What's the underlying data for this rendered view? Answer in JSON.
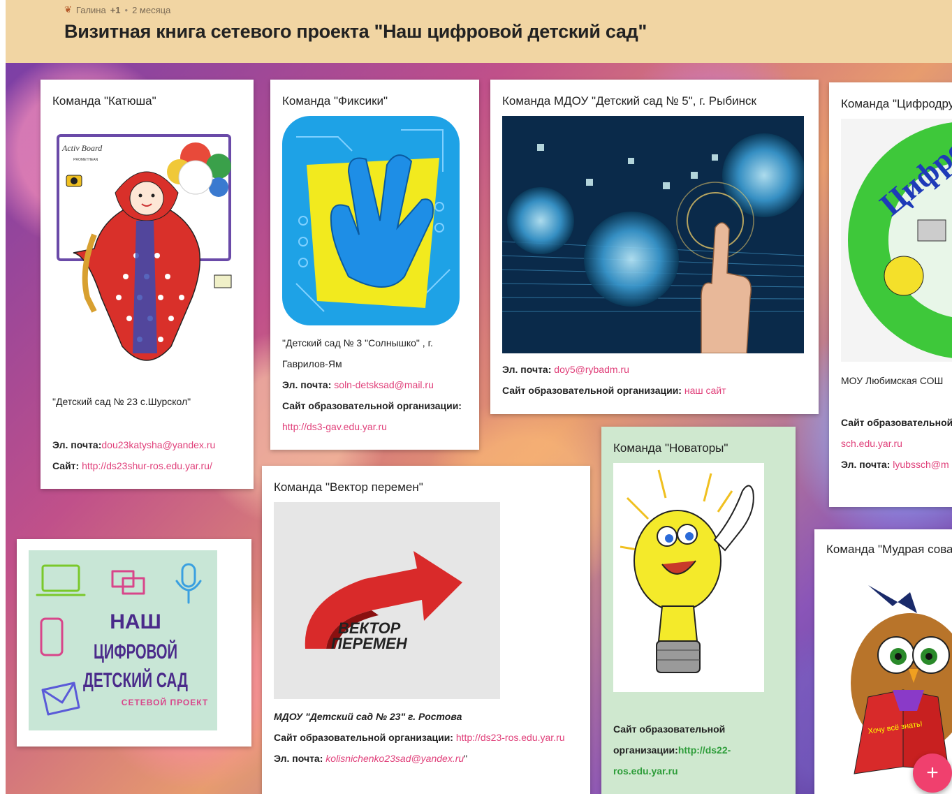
{
  "header": {
    "author": "Галина",
    "plus": "+1",
    "time": "2 месяца",
    "title": "Визитная книга сетевого проекта \"Наш цифровой детский сад\""
  },
  "cards": {
    "katyusha": {
      "title": "Команда \"Катюша\"",
      "img_board_text": "Activ Board",
      "img_board_brand": "PROMETHEAN",
      "org": "\"Детский сад  № 23 с.Шурскол\"",
      "email_label": "Эл. почта:",
      "email": "dou23katysha@yandex.ru",
      "site_label": "Сайт:",
      "site": "http://ds23shur-ros.edu.yar.ru/"
    },
    "fiksiki": {
      "title": "Команда \"Фиксики\"",
      "org": "\"Детский сад № 3 \"Солнышко\" , г. Гаврилов-Ям",
      "email_label": "Эл. почта:",
      "email": "soln-detsksad@mail.ru",
      "site_label": "Сайт образовательной организации:",
      "site": "http://ds3-gav.edu.yar.ru"
    },
    "mdou5": {
      "title": "Команда МДОУ \"Детский сад № 5\", г. Рыбинск",
      "email_label": "Эл. почта:",
      "email": "doy5@rybadm.ru",
      "site_label": "Сайт образовательной организации:",
      "site": "наш сайт"
    },
    "tsifrodr": {
      "title": "Команда \"Цифродру",
      "img_text": "Цифро",
      "org": "МОУ Любимская СОШ",
      "site_label": "Сайт образовательной",
      "site": "sch.edu.yar.ru",
      "email_label": "Эл. почта:",
      "email": "lyubssch@m"
    },
    "logo": {
      "line1": "НАШ",
      "line2": "ЦИФРОВОЙ",
      "line3": "ДЕТСКИЙ САД",
      "sub": "СЕТЕВОЙ ПРОЕКТ"
    },
    "vektor": {
      "title": "Команда \"Вектор перемен\"",
      "img_line1": "ВЕКТОР",
      "img_line2": "ПЕРЕМЕН",
      "org": "МДОУ \"Детский сад № 23\" г. Ростова",
      "site_label": "Сайт образовательной организации:",
      "site": "http://ds23-ros.edu.yar.ru",
      "email_label": "Эл. почта:",
      "email": "kolisnichenko23sad@yandex.ru",
      "email_tail": "\""
    },
    "novatory": {
      "title": "Команда \"Новаторы\"",
      "site_label": "Сайт образовательной организации:",
      "site": "http://ds22-ros.edu.yar.ru"
    },
    "sova": {
      "title": "Команда \"Мудрая сова",
      "book_text": "Хочу всё знать!"
    }
  },
  "fab": {
    "label": "+"
  },
  "colors": {
    "header_bg": "#f1d5a3",
    "link": "#e0407a",
    "fab": "#f0406e",
    "green_card": "#cfe8cf"
  }
}
